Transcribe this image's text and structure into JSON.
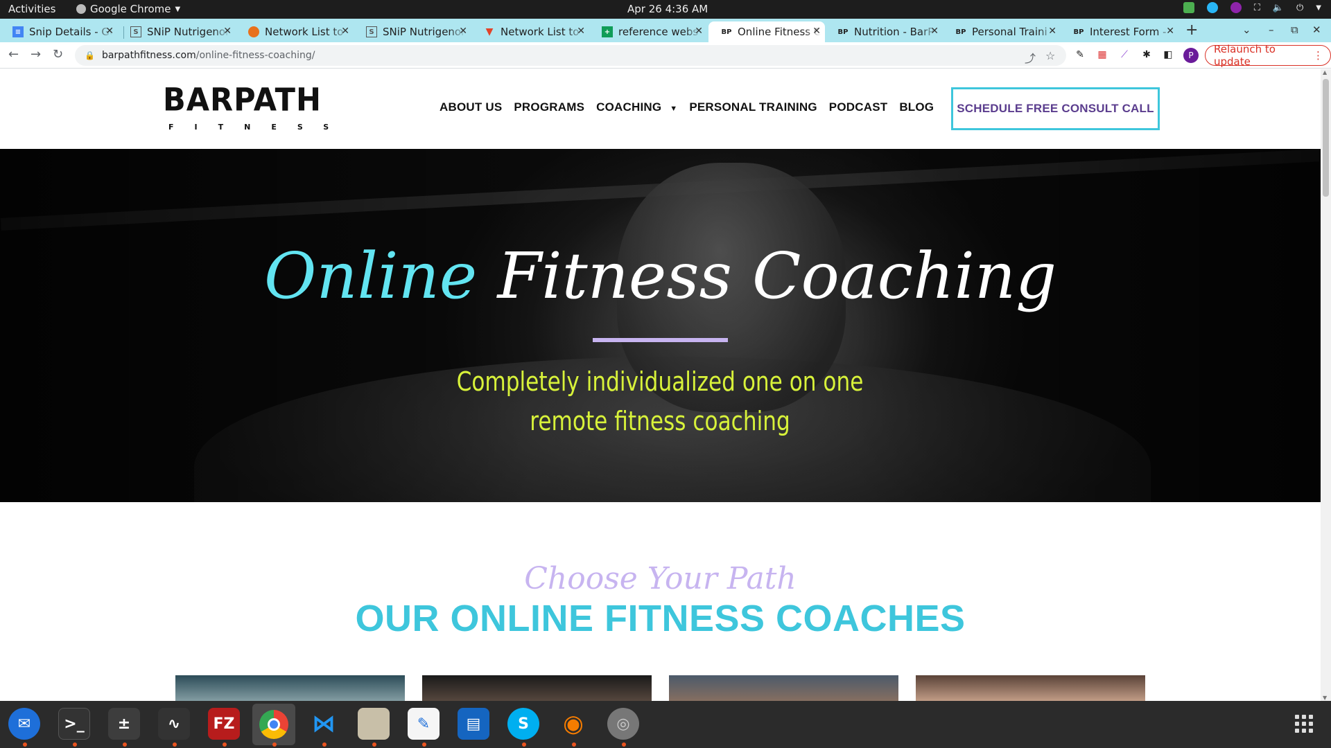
{
  "system": {
    "activities": "Activities",
    "app_name": "Google Chrome",
    "clock": "Apr 26  4:36 AM"
  },
  "tabs": [
    {
      "title": "Snip Details - Go",
      "favicon": "docs-icon",
      "color": "#4285f4"
    },
    {
      "title": "SNiP Nutrigenom",
      "favicon": "snip-icon",
      "color": "#555555"
    },
    {
      "title": "Network List to",
      "favicon": "sheets-color-icon",
      "color": "#e8711c"
    },
    {
      "title": "SNiP Nutrigenom",
      "favicon": "snip-icon",
      "color": "#555555"
    },
    {
      "title": "Network List to",
      "favicon": "gitlab-icon",
      "color": "#e24329"
    },
    {
      "title": "reference webs",
      "favicon": "sheets-icon",
      "color": "#0f9d58"
    },
    {
      "title": "Online Fitness C",
      "favicon": "barpath-icon",
      "color": "#111111"
    },
    {
      "title": "Nutrition - BarP",
      "favicon": "barpath-icon",
      "color": "#111111"
    },
    {
      "title": "Personal Traini",
      "favicon": "barpath-icon",
      "color": "#111111"
    },
    {
      "title": "Interest Form -",
      "favicon": "barpath-icon",
      "color": "#111111"
    }
  ],
  "active_tab_index": 6,
  "address_bar": {
    "host": "barpathfitness.com",
    "path": "/online-fitness-coaching/"
  },
  "toolbar": {
    "relaunch_label": "Relaunch to update",
    "profile_initial": "P"
  },
  "site": {
    "logo_word": "BARPATH",
    "logo_sub": "FITNESS",
    "nav": [
      "ABOUT US",
      "PROGRAMS",
      "COACHING",
      "PERSONAL TRAINING",
      "PODCAST",
      "BLOG"
    ],
    "cta": "SCHEDULE FREE CONSULT CALL",
    "hero": {
      "title_part1": "Online",
      "title_part2": "Fitness Coaching",
      "subtitle": "Completely individualized one on one remote fitness coaching"
    },
    "section_script": "Choose Your Path",
    "section_title": "OUR ONLINE FITNESS COACHES"
  },
  "colors": {
    "accent_cyan": "#3ec6dc",
    "hero_cyan": "#62e4f1",
    "hero_lime": "#d8f23a",
    "lavender": "#c7b4f0",
    "cta_purple": "#5b3d8e",
    "tabstrip": "#aee6f0"
  },
  "dock": [
    {
      "name": "thunderbird-icon"
    },
    {
      "name": "terminal-icon"
    },
    {
      "name": "calculator-icon"
    },
    {
      "name": "system-monitor-icon"
    },
    {
      "name": "filezilla-icon"
    },
    {
      "name": "chrome-icon"
    },
    {
      "name": "vscode-icon"
    },
    {
      "name": "files-icon"
    },
    {
      "name": "text-editor-icon"
    },
    {
      "name": "document-viewer-icon"
    },
    {
      "name": "skype-icon"
    },
    {
      "name": "blender-icon"
    },
    {
      "name": "disk-utility-icon"
    }
  ]
}
